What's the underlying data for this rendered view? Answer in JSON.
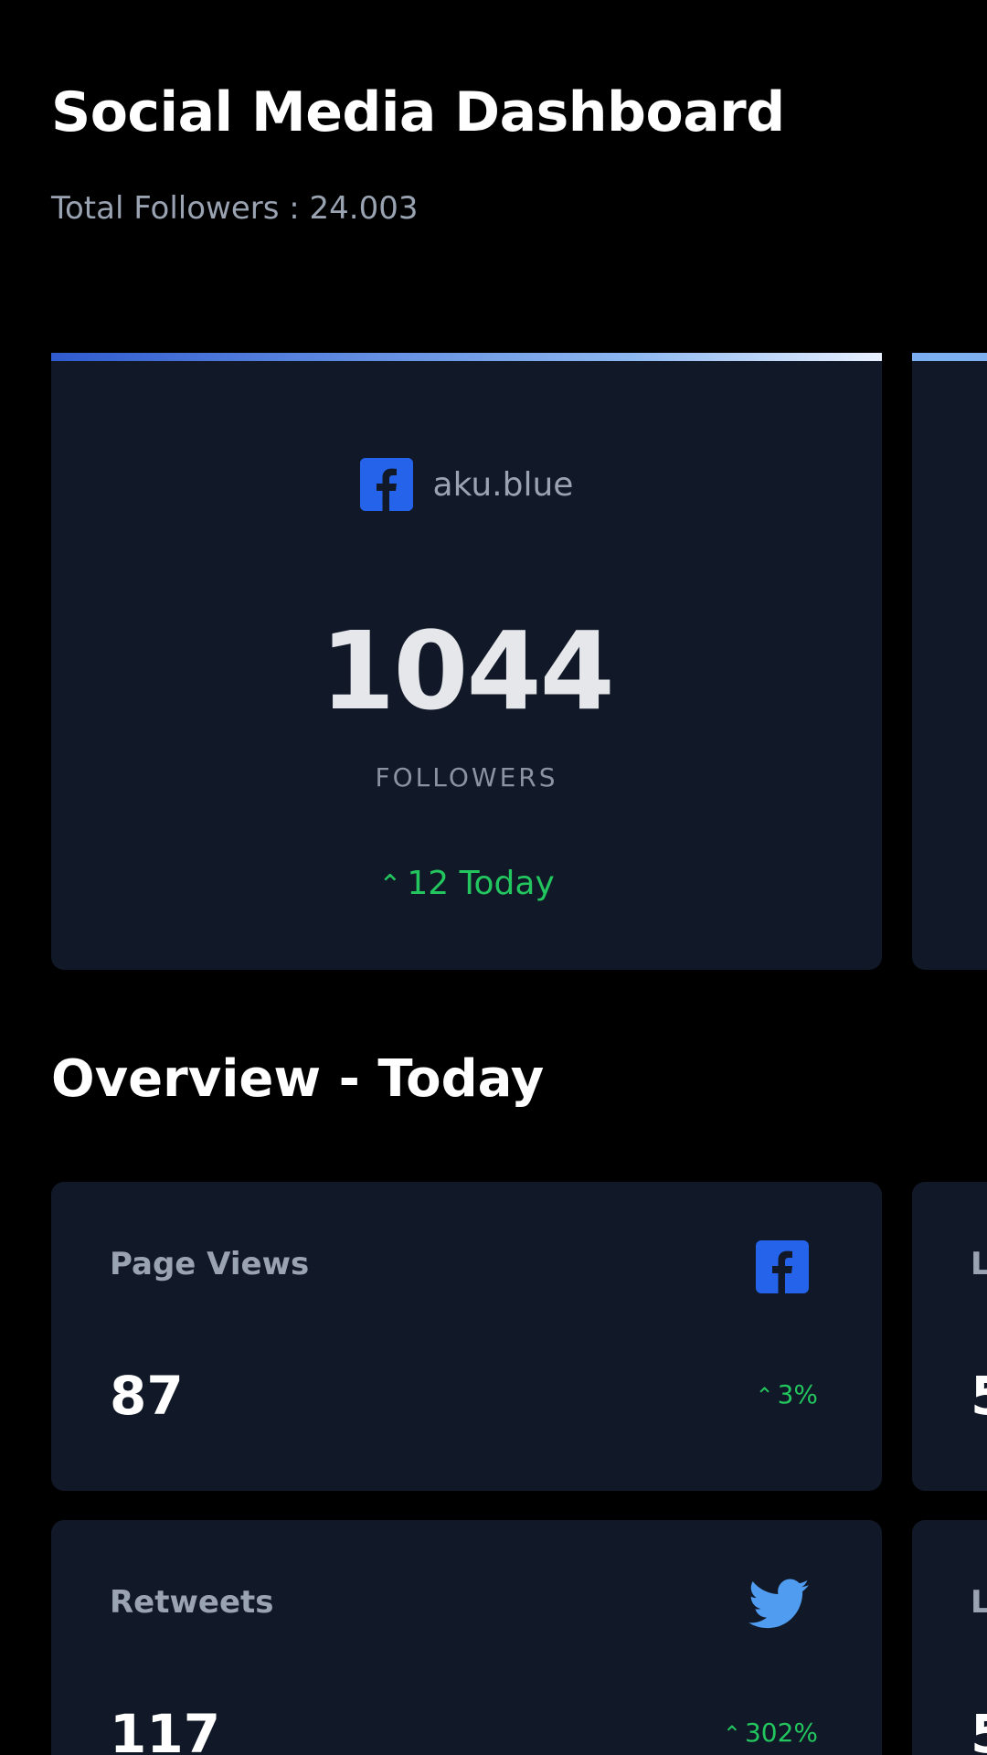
{
  "header": {
    "title": "Social Media Dashboard",
    "total_followers": "Total Followers : 24.003"
  },
  "follower_cards": [
    {
      "platform": "facebook",
      "icon": "facebook-icon",
      "handle": "aku.blue",
      "count": "1044",
      "label": "FOLLOWERS",
      "delta": "12 Today",
      "accent": "#2f5bd0"
    },
    {
      "platform": "twitter",
      "accent": "#7aaef0"
    }
  ],
  "overview": {
    "title": "Overview - Today",
    "cards": [
      {
        "label": "Page Views",
        "icon": "facebook-icon",
        "value": "87",
        "delta": "3%"
      },
      {
        "label": "L",
        "value": "5"
      },
      {
        "label": "Retweets",
        "icon": "twitter-icon",
        "value": "117",
        "delta": "302%"
      },
      {
        "label": "L",
        "value": "5"
      }
    ]
  },
  "colors": {
    "background": "#000000",
    "card": "#111827",
    "positive": "#22c55e",
    "facebook": "#2563eb",
    "twitter": "#4f9cf0"
  }
}
